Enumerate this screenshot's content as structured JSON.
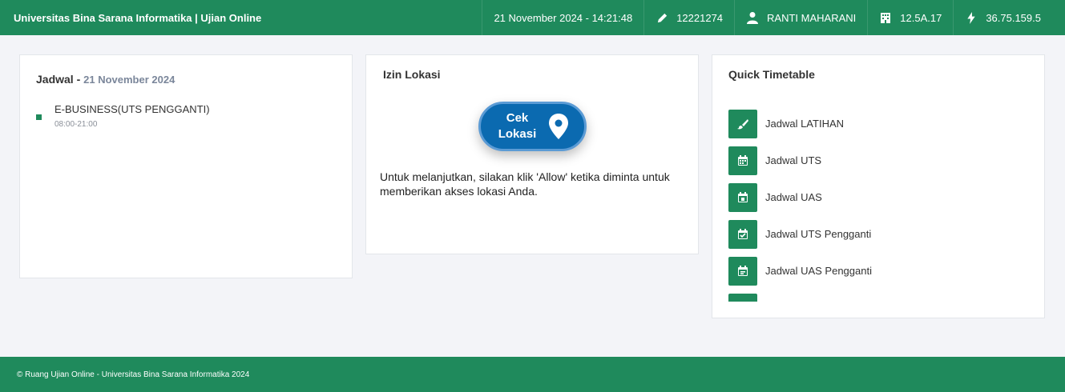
{
  "header": {
    "brand": "Universitas Bina Sarana Informatika | Ujian Online",
    "datetime": "21 November 2024 - 14:21:48",
    "nim": "12221274",
    "user_name": "RANTI MAHARANI",
    "class_code": "12.5A.17",
    "ip_address": "36.75.159.5",
    "icons": [
      "pencil-icon",
      "user-icon",
      "building-icon",
      "bolt-icon"
    ]
  },
  "jadwal": {
    "title": "Jadwal -",
    "date": "21 November 2024",
    "items": [
      {
        "name": "E-BUSINESS(UTS PENGGANTI)",
        "time": "08:00-21:00"
      }
    ]
  },
  "izin": {
    "title": "Izin Lokasi",
    "button_line1": "Cek",
    "button_line2": "Lokasi",
    "button_icon": "location-pin-icon",
    "instruction": "Untuk melanjutkan, silakan klik 'Allow' ketika diminta untuk memberikan akses lokasi Anda."
  },
  "quick": {
    "title": "Quick Timetable",
    "items": [
      {
        "label": "Jadwal LATIHAN",
        "icon": "brush-icon"
      },
      {
        "label": "Jadwal UTS",
        "icon": "calendar-icon"
      },
      {
        "label": "Jadwal UAS",
        "icon": "calendar-day-icon"
      },
      {
        "label": "Jadwal UTS Pengganti",
        "icon": "calendar-check-icon"
      },
      {
        "label": "Jadwal UAS Pengganti",
        "icon": "calendar-list-icon"
      }
    ]
  },
  "footer": {
    "copyright": "© Ruang Ujian Online - Universitas Bina Sarana Informatika 2024"
  },
  "colors": {
    "brand_green": "#1f8a5c",
    "button_blue": "#0b6ab0",
    "background": "#f3f4f8"
  }
}
